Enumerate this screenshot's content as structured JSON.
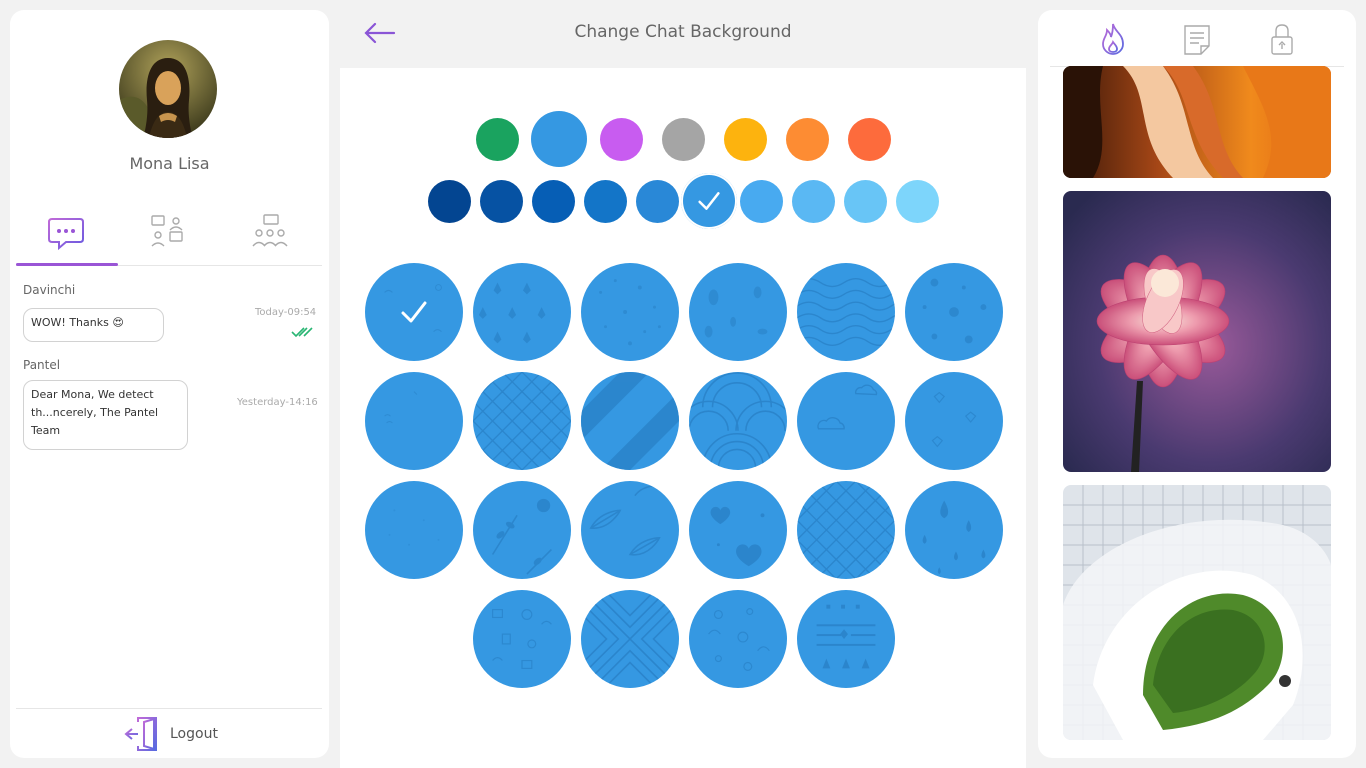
{
  "page": {
    "title": "Change Chat Background"
  },
  "profile": {
    "name": "Mona Lisa"
  },
  "left_tabs": [
    {
      "icon": "chat-bubble-icon",
      "active": true
    },
    {
      "icon": "contacts-chat-icon",
      "active": false
    },
    {
      "icon": "group-chat-icon",
      "active": false
    }
  ],
  "messages": [
    {
      "sender": "Davinchi",
      "text": "WOW! Thanks 😍",
      "time": "Today-09:54",
      "status_icon": "double-check-icon"
    },
    {
      "sender": "Pantel",
      "text": "Dear Mona, We detect th...ncerely, The Pantel Team",
      "time": "Yesterday-14:16"
    }
  ],
  "logout": {
    "label": "Logout",
    "icon": "logout-door-icon"
  },
  "colors": {
    "accent": "#9a55d6",
    "pattern_blue": "#3598e2",
    "row1": [
      "#1aa35f",
      "#3598e2",
      "#c85cf0",
      "#a5a5a5",
      "#fdb30e",
      "#fd8c33",
      "#fd6b3c"
    ],
    "row1_selected_index": 1,
    "row2": [
      "#034591",
      "#0652a3",
      "#065eb5",
      "#1375c8",
      "#2988d7",
      "#3598e2",
      "#48aaf0",
      "#5ab8f3",
      "#68c5f6",
      "#7dd5fb"
    ],
    "row2_selected_index": 5
  },
  "patterns": {
    "selected_index": 0,
    "items": [
      "plain-doodle",
      "fleur-de-lis",
      "stars-sparkles",
      "leaves-doodle",
      "waves",
      "dots",
      "sparse-doodle",
      "quatrefoil",
      "diagonal-stripes",
      "seigaiha",
      "clouds",
      "diamonds",
      "faint-texture",
      "branches",
      "big-leaves",
      "hearts",
      "lattice",
      "raindrops",
      "scribbles",
      "chevron-x",
      "circles-doodle",
      "tribal"
    ]
  },
  "right_tabs": [
    {
      "icon": "flame-icon",
      "active": true
    },
    {
      "icon": "document-icon",
      "active": false
    },
    {
      "icon": "lock-icon",
      "active": false
    }
  ],
  "wallpapers": [
    "canyon-rock",
    "pink-dahlia",
    "spiral-staircase"
  ]
}
